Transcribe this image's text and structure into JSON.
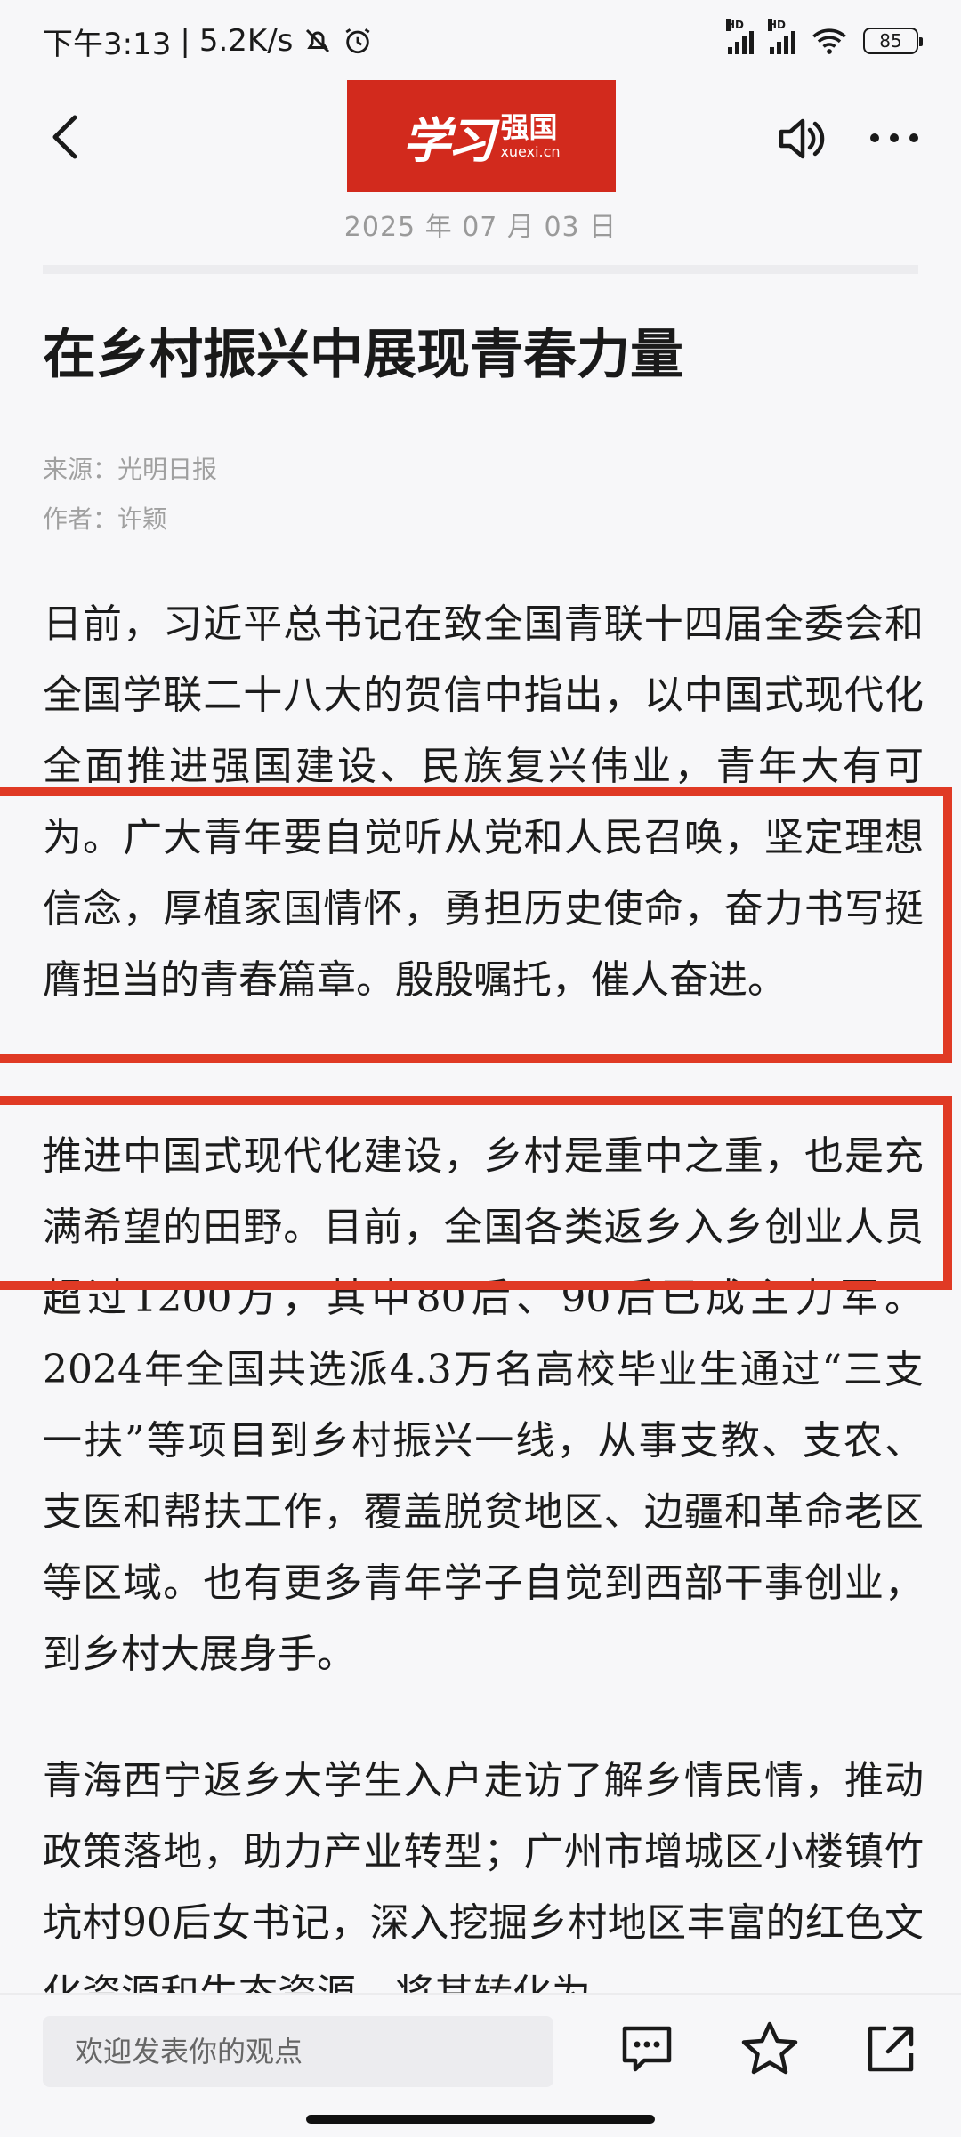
{
  "status_bar": {
    "time": "下午3:13",
    "separator": "|",
    "speed": "5.2K/s",
    "battery": "85",
    "hd_label": "HD"
  },
  "header": {
    "logo_text": "学习",
    "logo_cn": "强国",
    "logo_en": "xuexi.cn",
    "date": "2025 年 07 月 03 日"
  },
  "article": {
    "title": "在乡村振兴中展现青春力量",
    "source": "来源：光明日报",
    "author": "作者：许颖",
    "paragraphs": [
      "日前，习近平总书记在致全国青联十四届全委会和全国学联二十八大的贺信中指出，以中国式现代化全面推进强国建设、民族复兴伟业，青年大有可为。广大青年要自觉听从党和人民召唤，坚定理想信念，厚植家国情怀，勇担历史使命，奋力书写挺膺担当的青春篇章。殷殷嘱托，催人奋进。",
      "推进中国式现代化建设，乡村是重中之重，也是充满希望的田野。目前，全国各类返乡入乡创业人员超过1200万，其中80后、90后已成主力军。2024年全国共选派4.3万名高校毕业生通过“三支一扶”等项目到乡村振兴一线，从事支教、支农、支医和帮扶工作，覆盖脱贫地区、边疆和革命老区等区域。也有更多青年学子自觉到西部干事创业，到乡村大展身手。",
      "青海西宁返乡大学生入户走访了解乡情民情，推动政策落地，助力产业转型；广州市增城区小楼镇竹坑村90后女书记，深入挖掘乡村地区丰富的红色文化资源和生态资源，将其转化为"
    ]
  },
  "bottom_bar": {
    "comment_placeholder": "欢迎发表你的观点"
  },
  "colors": {
    "highlight_red": "#e03a25",
    "logo_red": "#d22a1d"
  }
}
